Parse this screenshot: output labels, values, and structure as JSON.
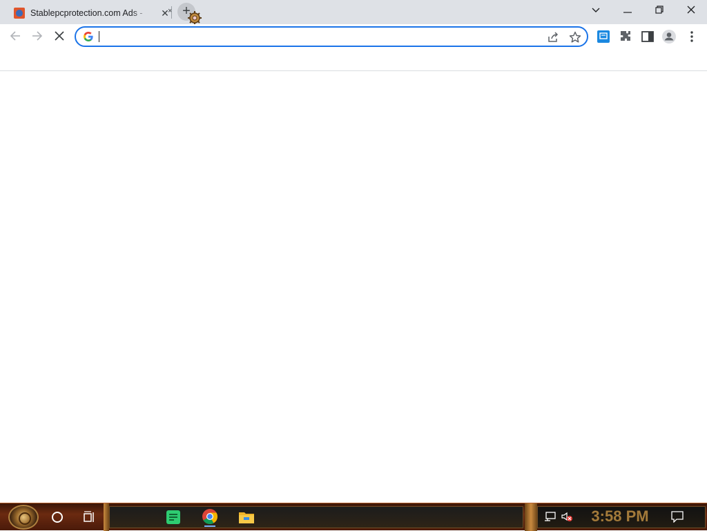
{
  "browser": {
    "tabs": [
      {
        "title": "Stablepcprotection.com Ads -  ",
        "close_glyph": "✕"
      },
      {
        "close_glyph": "×"
      }
    ],
    "new_tab_glyph": "+",
    "window_controls": {
      "dropdown": "⌄",
      "minimize": "—",
      "restore": "❐",
      "close": "✕"
    },
    "omnibox": {
      "value": "",
      "placeholder": ""
    },
    "accent_color": "#1a73e8"
  },
  "taskbar": {
    "clock": "3:58 PM",
    "pinned_apps": [
      "sticky-notes",
      "chrome",
      "file-explorer"
    ],
    "tray_icons": [
      "network-icon",
      "volume-muted-icon",
      "notification-icon"
    ]
  }
}
